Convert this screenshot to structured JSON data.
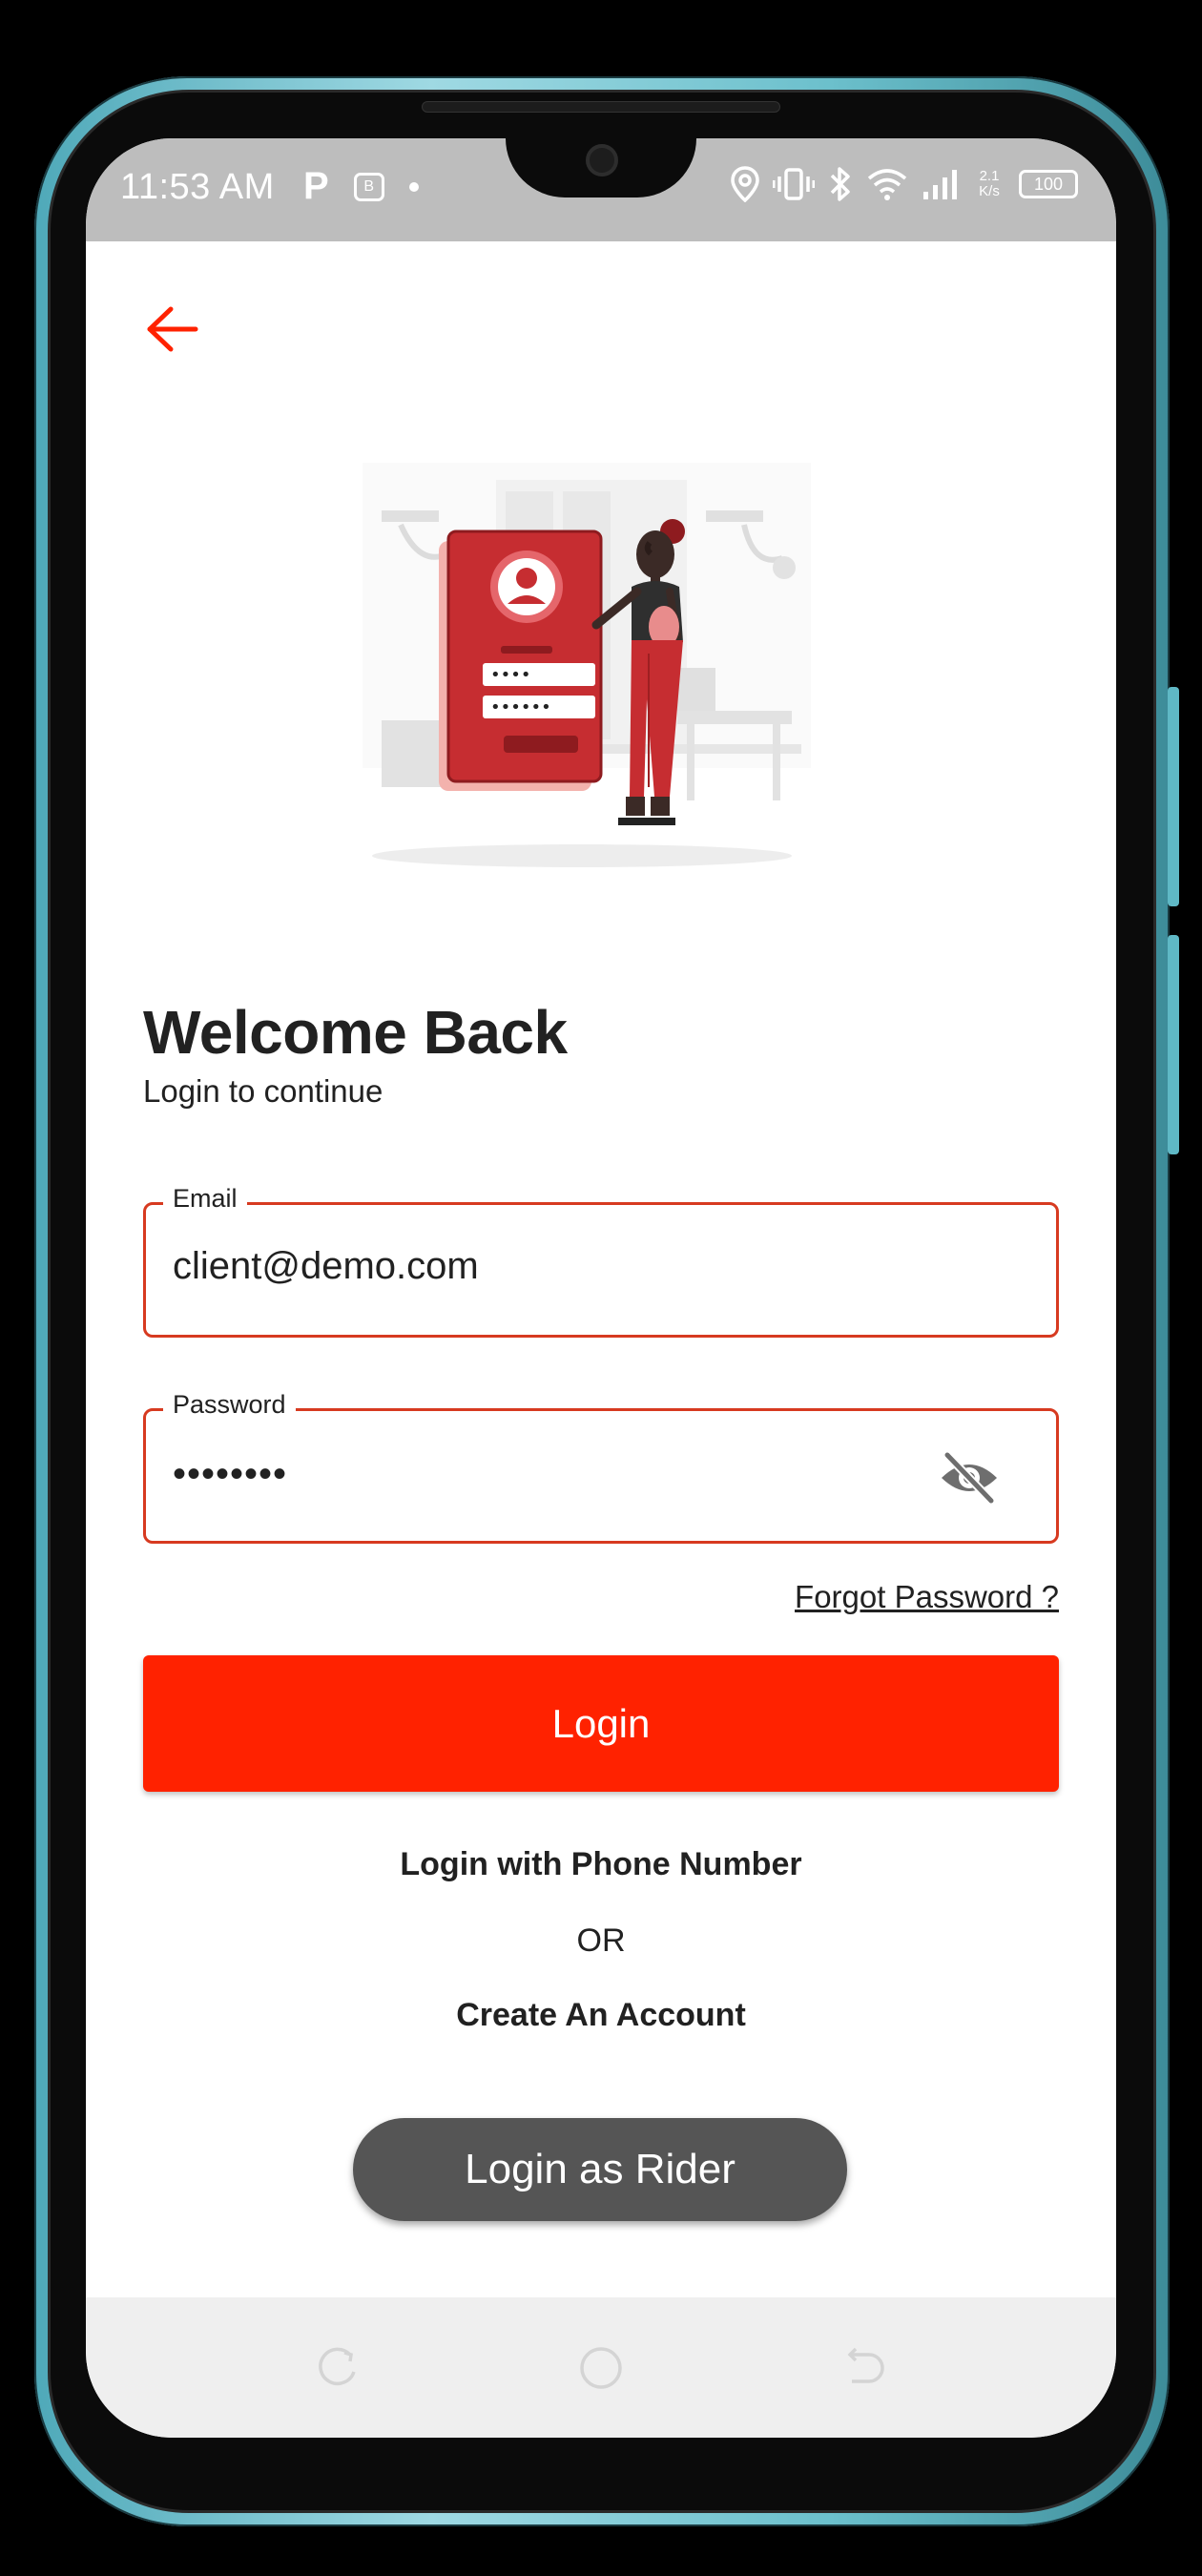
{
  "status_bar": {
    "time": "11:53 AM",
    "p_icon": "P",
    "badge": "B",
    "speed_top": "2.1",
    "speed_bottom": "K/s",
    "battery": "100"
  },
  "icons": {
    "back": "arrow-left-icon",
    "eye": "eye-off-icon",
    "location": "location-pin-icon",
    "vibrate": "vibrate-icon",
    "bluetooth": "bluetooth-icon",
    "wifi": "wifi-icon",
    "signal": "signal-icon"
  },
  "colors": {
    "accent": "#ff2200",
    "field_border": "#d73a20",
    "rider_button": "#555555",
    "text": "#212121"
  },
  "header": {
    "title": "Welcome Back",
    "subtitle": "Login to continue"
  },
  "form": {
    "email_label": "Email",
    "email_value": "client@demo.com",
    "password_label": "Password",
    "password_masked": "••••••••",
    "forgot_password": "Forgot Password ?",
    "login_button": "Login"
  },
  "alternatives": {
    "phone_login": "Login with Phone Number",
    "or": "OR",
    "create_account": "Create An Account",
    "rider_login": "Login as Rider"
  },
  "illustration": {
    "pin_dots": "••••",
    "password_dots": "••••••"
  }
}
